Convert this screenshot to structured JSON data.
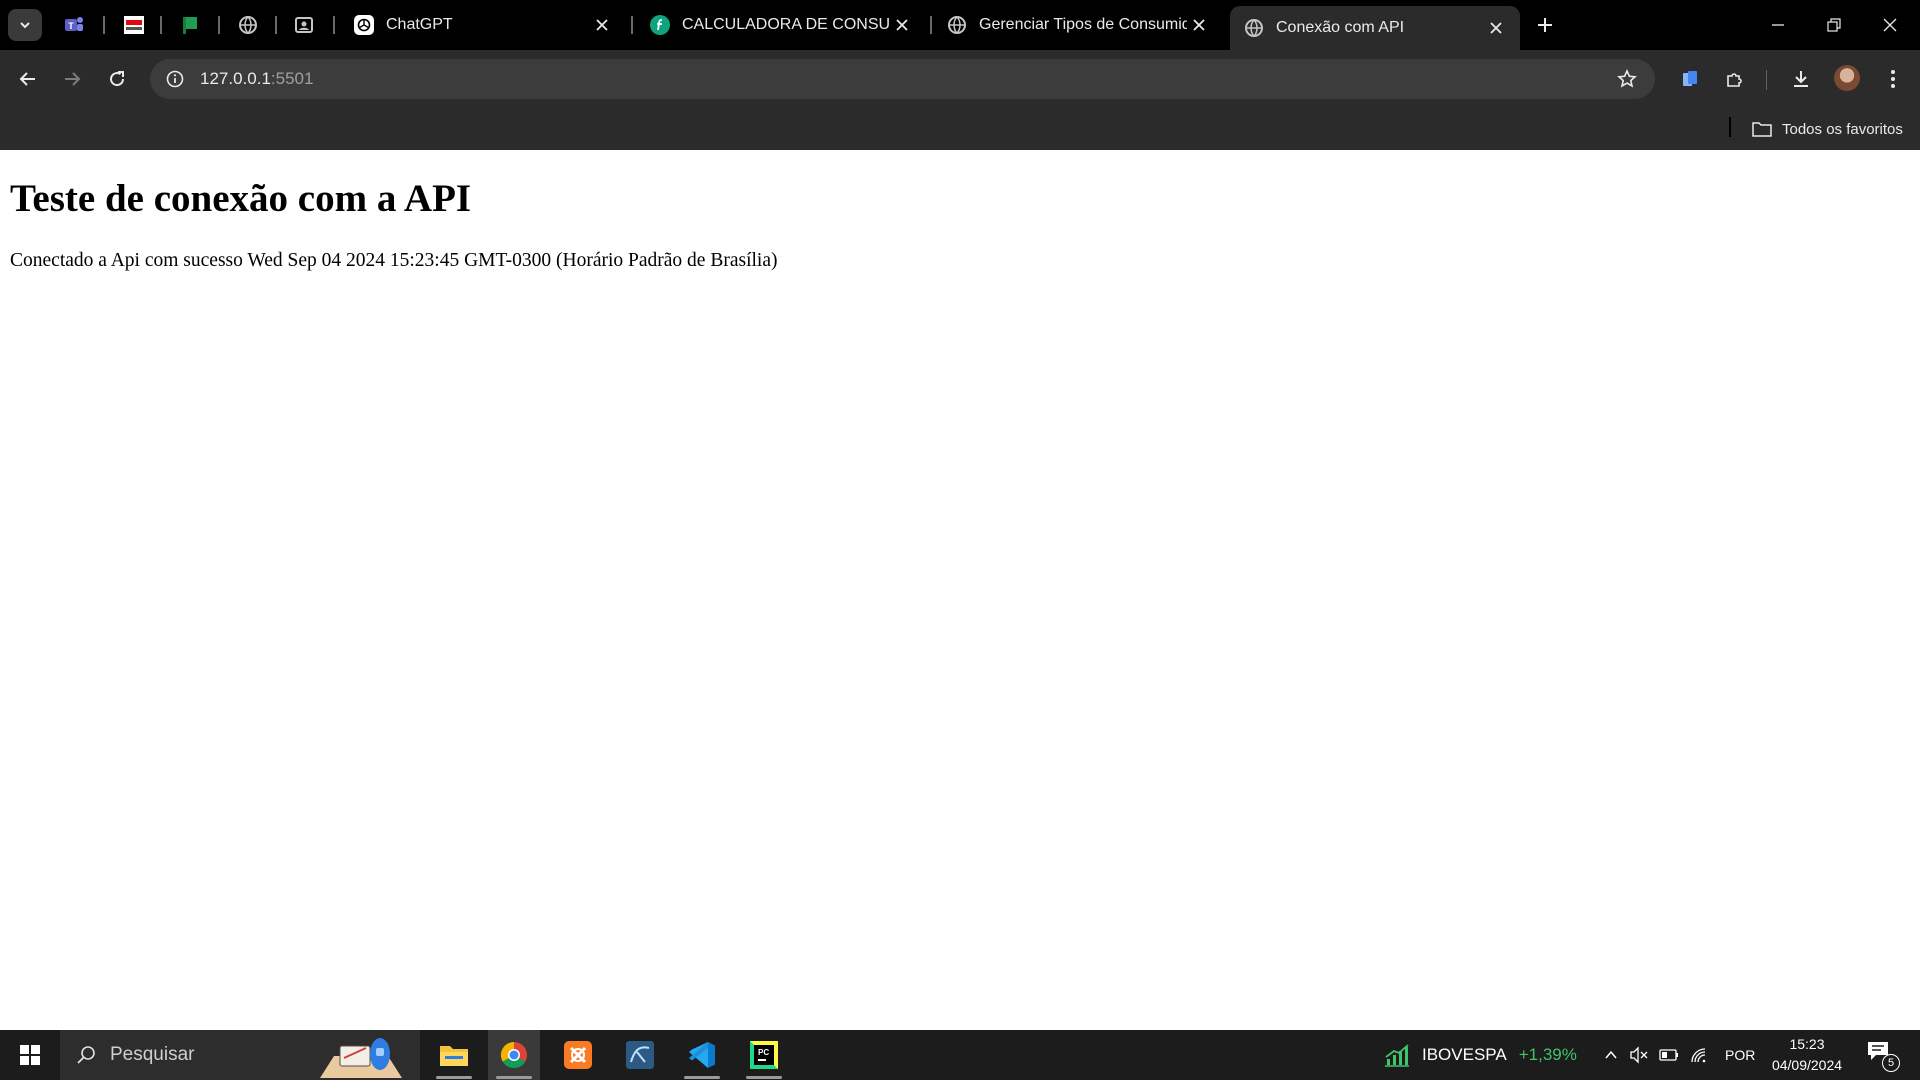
{
  "browser": {
    "pinned_tabs": [
      {
        "name": "teams-tab",
        "icon": "teams-icon"
      },
      {
        "name": "meu-senai-tab",
        "icon": "meu-senai-icon"
      },
      {
        "name": "green-flag-tab",
        "icon": "green-flag-icon"
      },
      {
        "name": "globe-tab",
        "icon": "globe-icon"
      },
      {
        "name": "contact-tab",
        "icon": "contact-icon"
      }
    ],
    "tabs": [
      {
        "title": "ChatGPT",
        "icon": "chatgpt-icon"
      },
      {
        "title": "CALCULADORA DE CONSUMO",
        "icon": "f-logo-icon"
      },
      {
        "title": "Gerenciar Tipos de Consumidor",
        "icon": "globe-icon"
      },
      {
        "title": "Conexão com API",
        "icon": "globe-icon",
        "active": true
      }
    ],
    "address_host": "127.0.0.1",
    "address_port": ":5501",
    "bookmarks_label": "Todos os favoritos"
  },
  "page": {
    "heading": "Teste de conexão com a API",
    "status": "Conectado a Api com sucesso Wed Sep 04 2024 15:23:45 GMT-0300 (Horário Padrão de Brasília)"
  },
  "taskbar": {
    "search_placeholder": "Pesquisar",
    "ticker_name": "IBOVESPA",
    "ticker_change": "+1,39%",
    "language": "POR",
    "time": "15:23",
    "date": "04/09/2024",
    "notification_count": "5",
    "colors": {
      "ticker_positive": "#3fc46a",
      "accent_blue": "#0078d4"
    }
  }
}
